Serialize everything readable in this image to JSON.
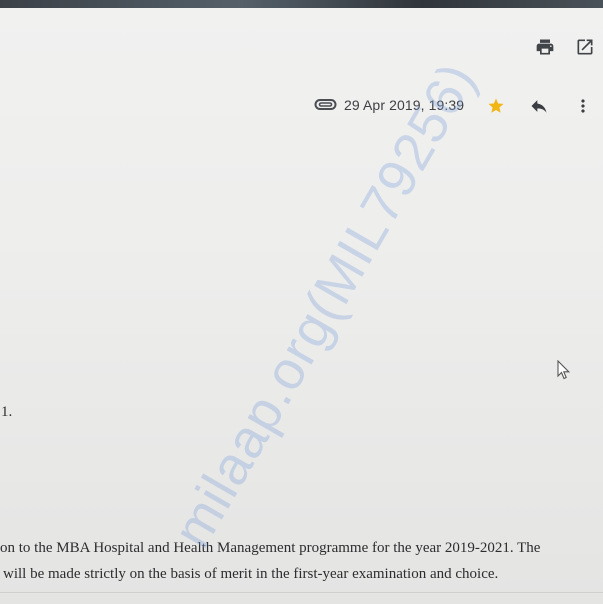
{
  "toolbar": {
    "print_icon": "print-icon",
    "open_new_window_icon": "open-in-new-window-icon"
  },
  "message": {
    "attachment_icon": "paperclip-icon",
    "date": "29 Apr 2019, 19:39",
    "star_icon": "star-icon",
    "star_color": "#f1b515",
    "reply_icon": "reply-icon",
    "more_icon": "more-vert-icon"
  },
  "body": {
    "fragment": "1.",
    "line1": "on to the MBA Hospital and Health Management programme for the year 2019-2021. The",
    "line2": "will be made strictly on the basis of merit in the first-year examination and choice."
  },
  "watermark": "milaap.org(MIL79256)"
}
